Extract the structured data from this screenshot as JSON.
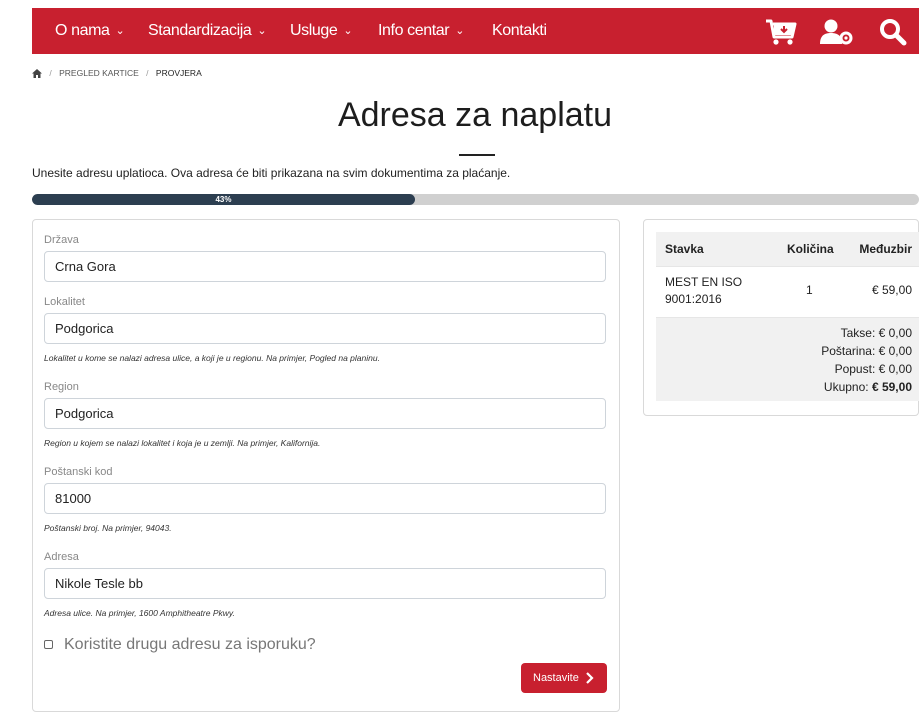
{
  "nav": {
    "items": [
      {
        "label": "O nama",
        "has_dropdown": true
      },
      {
        "label": "Standardizacija",
        "has_dropdown": true
      },
      {
        "label": "Usluge",
        "has_dropdown": true
      },
      {
        "label": "Info centar",
        "has_dropdown": true
      },
      {
        "label": "Kontakti",
        "has_dropdown": false
      }
    ],
    "icons": [
      "cart-download-icon",
      "user-settings-icon",
      "search-icon"
    ],
    "brand_color": "#c8202f"
  },
  "breadcrumb": {
    "home_icon": "home-icon",
    "items": [
      "PREGLED KARTICE",
      "PROVJERA"
    ]
  },
  "page": {
    "title": "Adresa za naplatu",
    "intro": "Unesite adresu uplatioca. Ova adresa će biti prikazana na svim dokumentima za plaćanje."
  },
  "progress": {
    "value_percent": 43,
    "label": "43%",
    "fill_color": "#2c3e50"
  },
  "form": {
    "country": {
      "label": "Država",
      "value": "Crna Gora"
    },
    "locality": {
      "label": "Lokalitet",
      "value": "Podgorica",
      "help": "Lokalitet u kome se nalazi adresa ulice, a koji je u regionu. Na primjer, Pogled na planinu."
    },
    "region": {
      "label": "Region",
      "value": "Podgorica",
      "help": "Region u kojem se nalazi lokalitet i koja je u zemlji. Na primjer, Kalifornija."
    },
    "postal_code": {
      "label": "Poštanski kod",
      "value": "81000",
      "help": "Poštanski broj. Na primjer, 94043."
    },
    "address": {
      "label": "Adresa",
      "value": "Nikole Tesle bb",
      "help": "Adresa ulice. Na primjer, 1600 Amphitheatre Pkwy."
    },
    "different_shipping": {
      "label": "Koristite drugu adresu za isporuku?",
      "checked": false
    },
    "continue_label": "Nastavite"
  },
  "summary": {
    "headers": {
      "item": "Stavka",
      "qty": "Količina",
      "subtotal": "Međuzbir"
    },
    "rows": [
      {
        "item": "MEST EN ISO 9001:2016",
        "qty": "1",
        "subtotal": "€ 59,00"
      }
    ],
    "totals": {
      "tax_label": "Takse:",
      "tax": "€ 0,00",
      "shipping_label": "Poštarina:",
      "shipping": "€ 0,00",
      "discount_label": "Popust:",
      "discount": "€ 0,00",
      "total_label": "Ukupno:",
      "total": "€ 59,00"
    }
  }
}
